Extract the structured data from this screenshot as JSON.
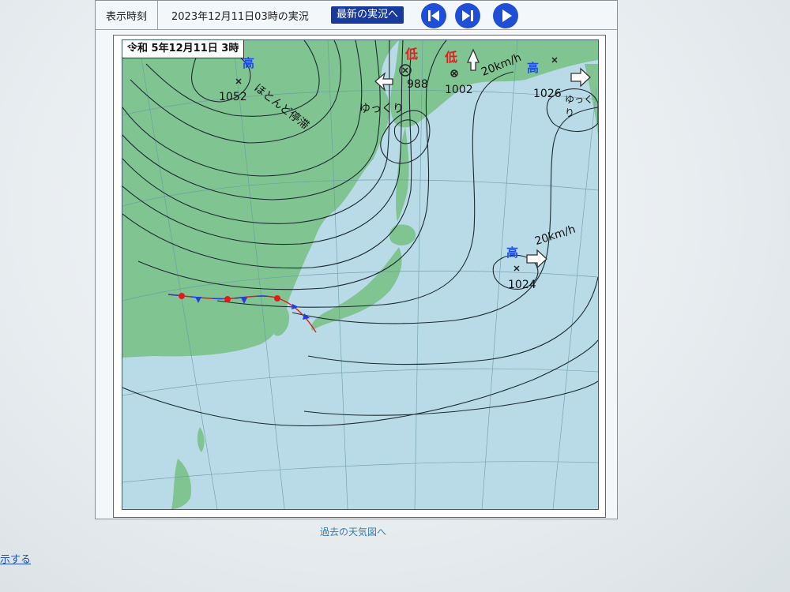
{
  "toolbar": {
    "label": "表示時刻",
    "datetime": "2023年12月11日03時の実況",
    "latest_button": "最新の実況へ"
  },
  "map": {
    "stamp": "令和 5年12月11日 3時",
    "pressure_systems": [
      {
        "type": "高",
        "pressure": "1052",
        "note": "ほとんど停滞"
      },
      {
        "type": "低",
        "pressure": "988",
        "note": "ゆっくり"
      },
      {
        "type": "低",
        "pressure": "1002",
        "note": "20km/h"
      },
      {
        "type": "高",
        "pressure": "1026",
        "note": "ゆっくり"
      },
      {
        "type": "高",
        "pressure": "1024",
        "note": "20km/h"
      }
    ]
  },
  "footer": {
    "past_link": "過去の天気図へ",
    "left_link": "示する"
  },
  "colors": {
    "sea": "#b7dbe8",
    "land": "#7fc28f",
    "isobar": "#1d2b33",
    "high": "#1f4fe0",
    "low": "#e02020",
    "button": "#1f4fd6"
  }
}
